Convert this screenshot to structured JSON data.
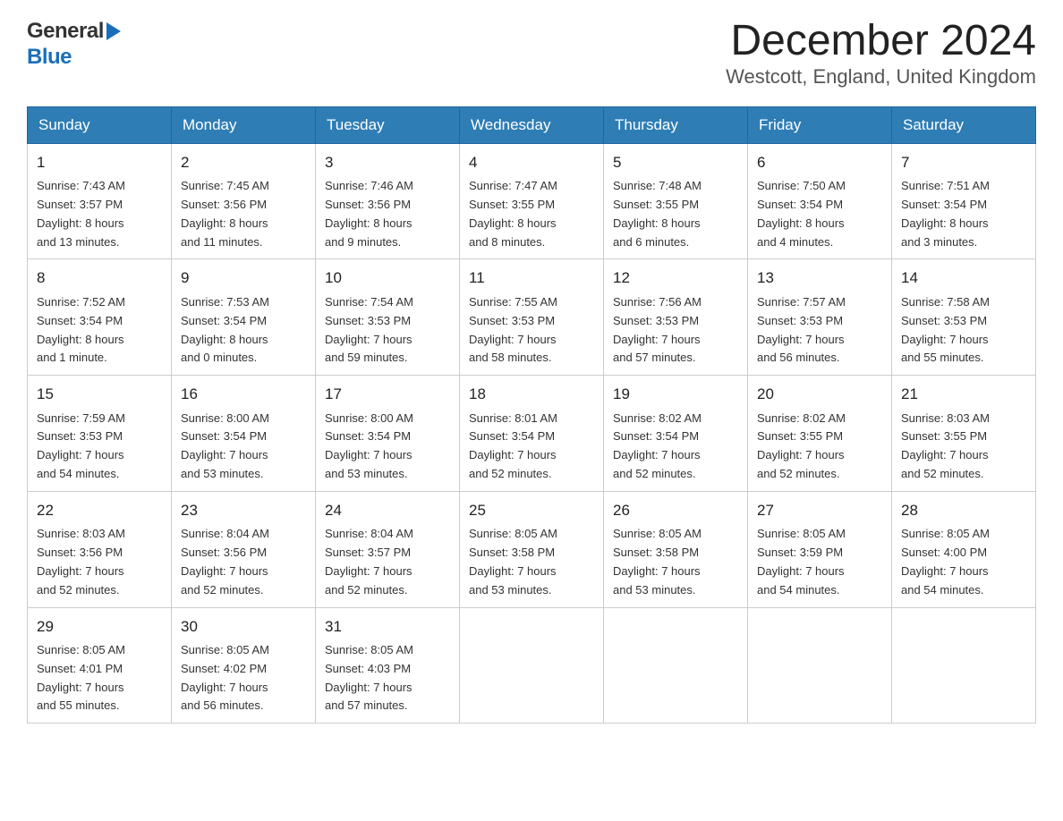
{
  "header": {
    "logo_general": "General",
    "logo_blue": "Blue",
    "month_title": "December 2024",
    "location": "Westcott, England, United Kingdom"
  },
  "weekdays": [
    "Sunday",
    "Monday",
    "Tuesday",
    "Wednesday",
    "Thursday",
    "Friday",
    "Saturday"
  ],
  "weeks": [
    [
      {
        "day": "1",
        "sunrise": "7:43 AM",
        "sunset": "3:57 PM",
        "daylight": "8 hours and 13 minutes."
      },
      {
        "day": "2",
        "sunrise": "7:45 AM",
        "sunset": "3:56 PM",
        "daylight": "8 hours and 11 minutes."
      },
      {
        "day": "3",
        "sunrise": "7:46 AM",
        "sunset": "3:56 PM",
        "daylight": "8 hours and 9 minutes."
      },
      {
        "day": "4",
        "sunrise": "7:47 AM",
        "sunset": "3:55 PM",
        "daylight": "8 hours and 8 minutes."
      },
      {
        "day": "5",
        "sunrise": "7:48 AM",
        "sunset": "3:55 PM",
        "daylight": "8 hours and 6 minutes."
      },
      {
        "day": "6",
        "sunrise": "7:50 AM",
        "sunset": "3:54 PM",
        "daylight": "8 hours and 4 minutes."
      },
      {
        "day": "7",
        "sunrise": "7:51 AM",
        "sunset": "3:54 PM",
        "daylight": "8 hours and 3 minutes."
      }
    ],
    [
      {
        "day": "8",
        "sunrise": "7:52 AM",
        "sunset": "3:54 PM",
        "daylight": "8 hours and 1 minute."
      },
      {
        "day": "9",
        "sunrise": "7:53 AM",
        "sunset": "3:54 PM",
        "daylight": "8 hours and 0 minutes."
      },
      {
        "day": "10",
        "sunrise": "7:54 AM",
        "sunset": "3:53 PM",
        "daylight": "7 hours and 59 minutes."
      },
      {
        "day": "11",
        "sunrise": "7:55 AM",
        "sunset": "3:53 PM",
        "daylight": "7 hours and 58 minutes."
      },
      {
        "day": "12",
        "sunrise": "7:56 AM",
        "sunset": "3:53 PM",
        "daylight": "7 hours and 57 minutes."
      },
      {
        "day": "13",
        "sunrise": "7:57 AM",
        "sunset": "3:53 PM",
        "daylight": "7 hours and 56 minutes."
      },
      {
        "day": "14",
        "sunrise": "7:58 AM",
        "sunset": "3:53 PM",
        "daylight": "7 hours and 55 minutes."
      }
    ],
    [
      {
        "day": "15",
        "sunrise": "7:59 AM",
        "sunset": "3:53 PM",
        "daylight": "7 hours and 54 minutes."
      },
      {
        "day": "16",
        "sunrise": "8:00 AM",
        "sunset": "3:54 PM",
        "daylight": "7 hours and 53 minutes."
      },
      {
        "day": "17",
        "sunrise": "8:00 AM",
        "sunset": "3:54 PM",
        "daylight": "7 hours and 53 minutes."
      },
      {
        "day": "18",
        "sunrise": "8:01 AM",
        "sunset": "3:54 PM",
        "daylight": "7 hours and 52 minutes."
      },
      {
        "day": "19",
        "sunrise": "8:02 AM",
        "sunset": "3:54 PM",
        "daylight": "7 hours and 52 minutes."
      },
      {
        "day": "20",
        "sunrise": "8:02 AM",
        "sunset": "3:55 PM",
        "daylight": "7 hours and 52 minutes."
      },
      {
        "day": "21",
        "sunrise": "8:03 AM",
        "sunset": "3:55 PM",
        "daylight": "7 hours and 52 minutes."
      }
    ],
    [
      {
        "day": "22",
        "sunrise": "8:03 AM",
        "sunset": "3:56 PM",
        "daylight": "7 hours and 52 minutes."
      },
      {
        "day": "23",
        "sunrise": "8:04 AM",
        "sunset": "3:56 PM",
        "daylight": "7 hours and 52 minutes."
      },
      {
        "day": "24",
        "sunrise": "8:04 AM",
        "sunset": "3:57 PM",
        "daylight": "7 hours and 52 minutes."
      },
      {
        "day": "25",
        "sunrise": "8:05 AM",
        "sunset": "3:58 PM",
        "daylight": "7 hours and 53 minutes."
      },
      {
        "day": "26",
        "sunrise": "8:05 AM",
        "sunset": "3:58 PM",
        "daylight": "7 hours and 53 minutes."
      },
      {
        "day": "27",
        "sunrise": "8:05 AM",
        "sunset": "3:59 PM",
        "daylight": "7 hours and 54 minutes."
      },
      {
        "day": "28",
        "sunrise": "8:05 AM",
        "sunset": "4:00 PM",
        "daylight": "7 hours and 54 minutes."
      }
    ],
    [
      {
        "day": "29",
        "sunrise": "8:05 AM",
        "sunset": "4:01 PM",
        "daylight": "7 hours and 55 minutes."
      },
      {
        "day": "30",
        "sunrise": "8:05 AM",
        "sunset": "4:02 PM",
        "daylight": "7 hours and 56 minutes."
      },
      {
        "day": "31",
        "sunrise": "8:05 AM",
        "sunset": "4:03 PM",
        "daylight": "7 hours and 57 minutes."
      },
      null,
      null,
      null,
      null
    ]
  ],
  "labels": {
    "sunrise": "Sunrise:",
    "sunset": "Sunset:",
    "daylight": "Daylight:"
  }
}
